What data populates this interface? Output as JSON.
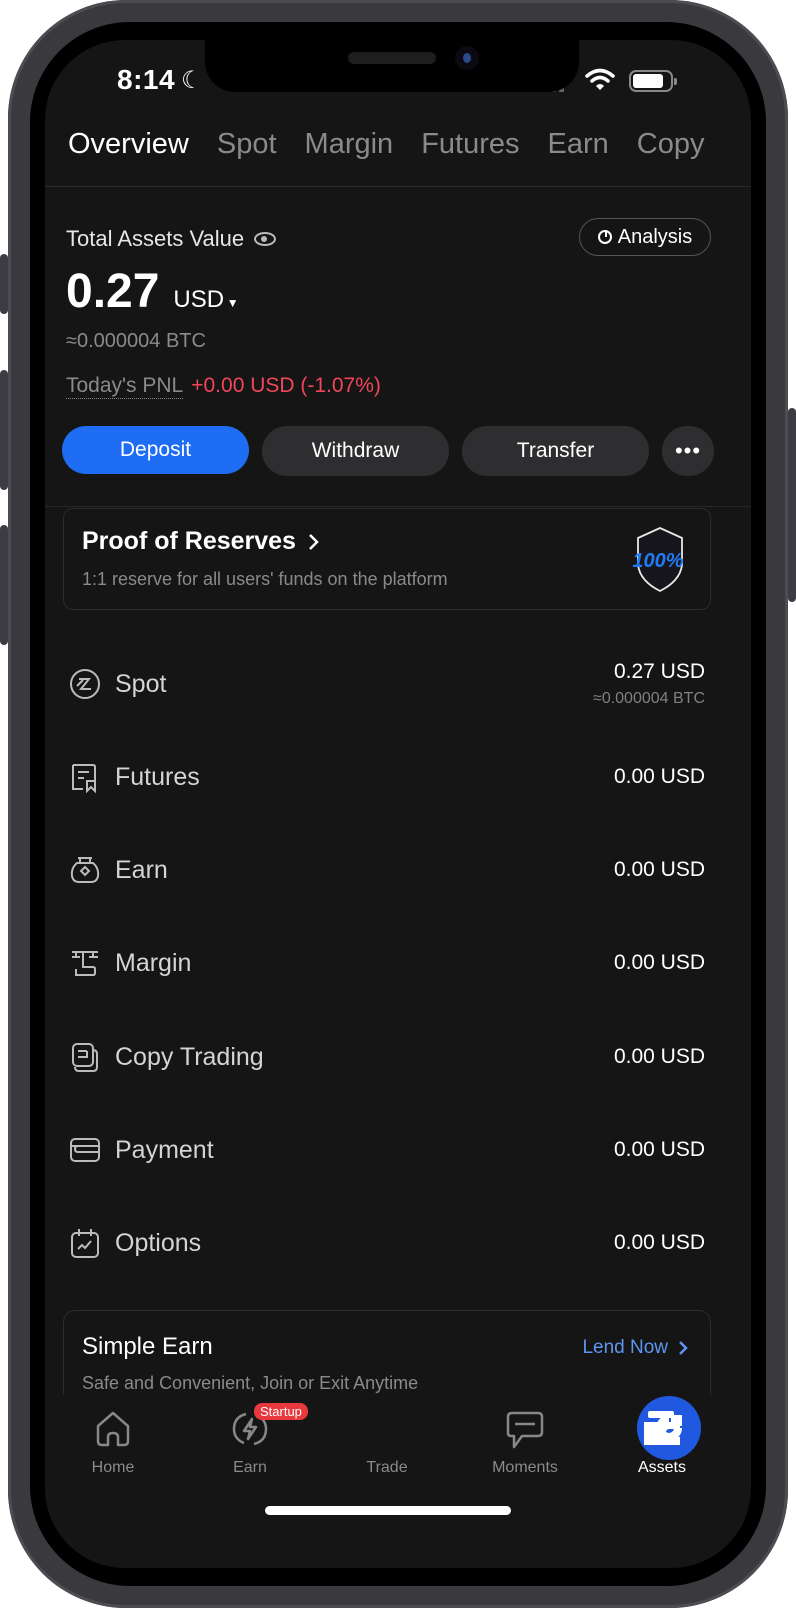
{
  "status_bar": {
    "time": "8:14"
  },
  "tabs": [
    {
      "label": "Overview",
      "active": true
    },
    {
      "label": "Spot",
      "active": false
    },
    {
      "label": "Margin",
      "active": false
    },
    {
      "label": "Futures",
      "active": false
    },
    {
      "label": "Earn",
      "active": false
    },
    {
      "label": "Copy",
      "active": false
    }
  ],
  "summary": {
    "label": "Total Assets Value",
    "analysis_label": "Analysis",
    "value": "0.27",
    "currency": "USD",
    "btc_approx": "≈0.000004 BTC",
    "pnl_label": "Today's PNL",
    "pnl_value": "+0.00 USD (-1.07%)"
  },
  "actions": {
    "deposit": "Deposit",
    "withdraw": "Withdraw",
    "transfer": "Transfer",
    "more": "•••"
  },
  "proof_of_reserves": {
    "title": "Proof of Reserves",
    "subtitle": "1:1 reserve for all users' funds on the platform",
    "badge": "100%"
  },
  "assets": [
    {
      "name": "Spot",
      "icon": "spot-icon",
      "usd": "0.27 USD",
      "btc": "≈0.000004 BTC"
    },
    {
      "name": "Futures",
      "icon": "futures-icon",
      "usd": "0.00 USD"
    },
    {
      "name": "Earn",
      "icon": "earn-icon",
      "usd": "0.00 USD"
    },
    {
      "name": "Margin",
      "icon": "margin-icon",
      "usd": "0.00 USD"
    },
    {
      "name": "Copy Trading",
      "icon": "copy-trading-icon",
      "usd": "0.00 USD"
    },
    {
      "name": "Payment",
      "icon": "payment-icon",
      "usd": "0.00 USD"
    },
    {
      "name": "Options",
      "icon": "options-icon",
      "usd": "0.00 USD"
    }
  ],
  "simple_earn": {
    "title": "Simple Earn",
    "link": "Lend Now",
    "subtitle": "Safe and Convenient, Join or Exit Anytime"
  },
  "bottom_nav": [
    {
      "label": "Home",
      "icon": "home-icon",
      "active": false
    },
    {
      "label": "Earn",
      "icon": "earn-nav-icon",
      "active": false,
      "badge": "Startup"
    },
    {
      "label": "Trade",
      "icon": "trade-icon",
      "active": false
    },
    {
      "label": "Moments",
      "icon": "moments-icon",
      "active": false
    },
    {
      "label": "Assets",
      "icon": "wallet-icon",
      "active": true
    }
  ],
  "colors": {
    "accent": "#1f6df5",
    "pnl_negative": "#f0465a",
    "link": "#5d95f0",
    "badge": "#e8393f"
  }
}
